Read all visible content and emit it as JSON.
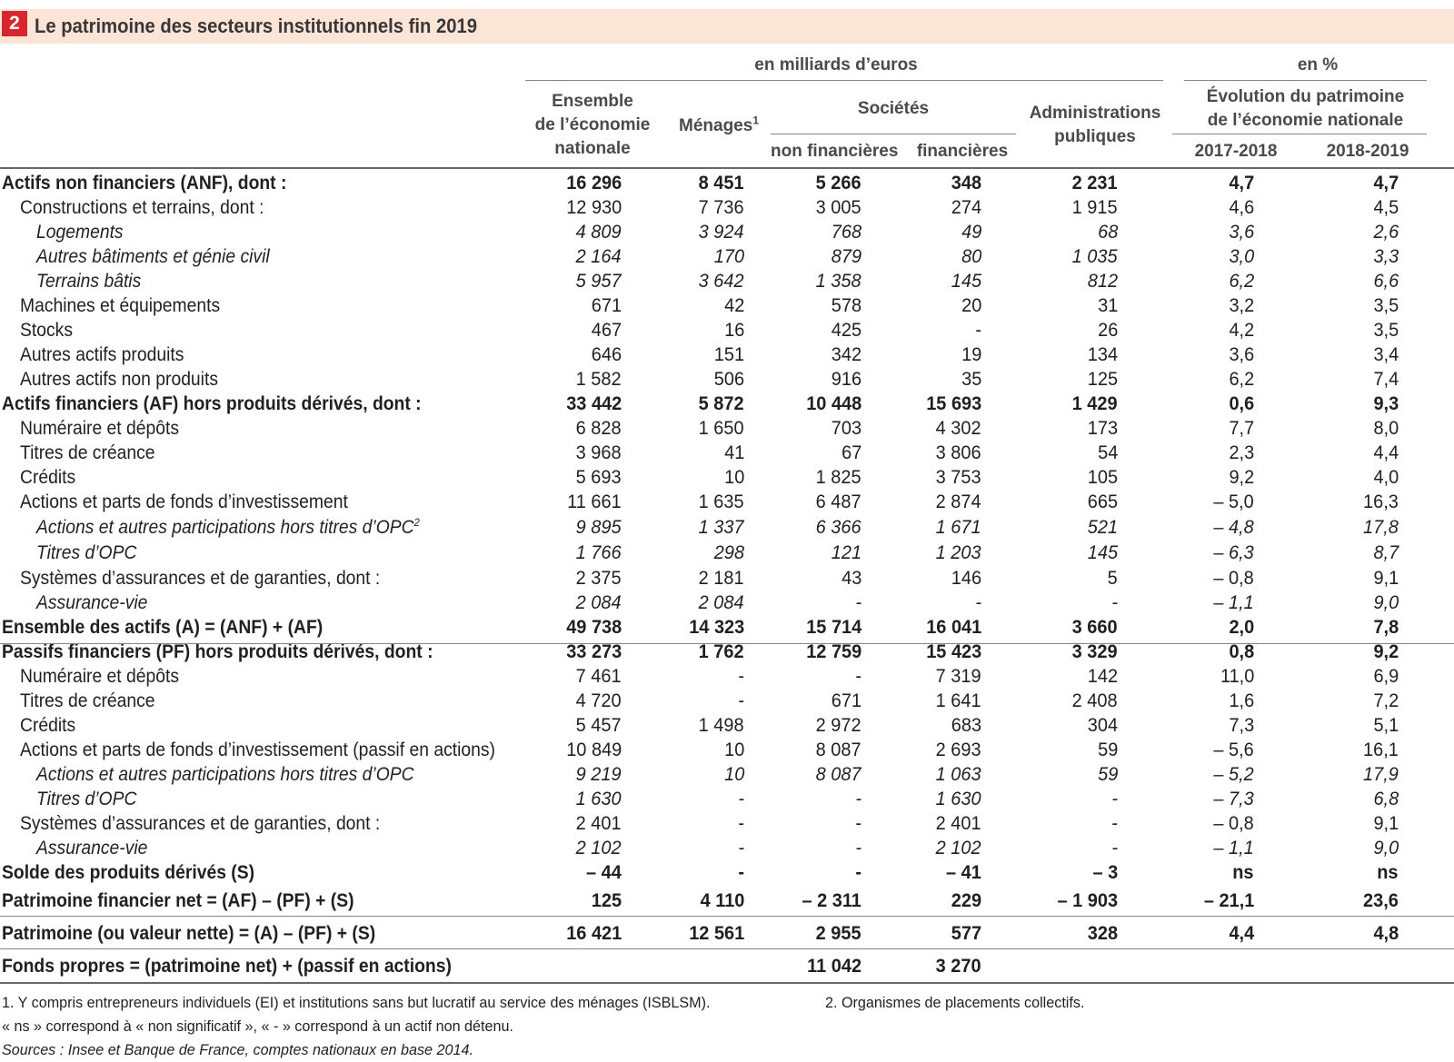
{
  "title": {
    "number": "2",
    "text": "Le patrimoine des secteurs institutionnels fin 2019"
  },
  "header": {
    "unit_eur": "en milliards d’euros",
    "unit_pct": "en %",
    "col_ensemble": [
      "Ensemble",
      "de l’économie",
      "nationale"
    ],
    "col_menages": "Ménages",
    "col_menages_note": "1",
    "col_societes": "Sociétés",
    "col_soc_nf": "non financières",
    "col_soc_f": "financières",
    "col_admin": [
      "Administrations",
      "publiques"
    ],
    "col_evol": [
      "Évolution du patrimoine",
      "de l’économie nationale"
    ],
    "col_2018": "2017-2018",
    "col_2019": "2018-2019"
  },
  "rows": [
    {
      "label": "Actifs non financiers (ANF), dont :",
      "style": "bold",
      "v": [
        "16 296",
        "8 451",
        "5 266",
        "348",
        "2 231",
        "4,7",
        "4,7"
      ]
    },
    {
      "label": "Constructions et terrains, dont :",
      "style": "l1",
      "v": [
        "12 930",
        "7 736",
        "3 005",
        "274",
        "1 915",
        "4,6",
        "4,5"
      ]
    },
    {
      "label": "Logements",
      "style": "l2",
      "v": [
        "4 809",
        "3 924",
        "768",
        "49",
        "68",
        "3,6",
        "2,6"
      ]
    },
    {
      "label": "Autres bâtiments et génie civil",
      "style": "l2",
      "v": [
        "2 164",
        "170",
        "879",
        "80",
        "1 035",
        "3,0",
        "3,3"
      ]
    },
    {
      "label": "Terrains bâtis",
      "style": "l2",
      "v": [
        "5 957",
        "3 642",
        "1 358",
        "145",
        "812",
        "6,2",
        "6,6"
      ]
    },
    {
      "label": "Machines et équipements",
      "style": "l1",
      "v": [
        "671",
        "42",
        "578",
        "20",
        "31",
        "3,2",
        "3,5"
      ]
    },
    {
      "label": "Stocks",
      "style": "l1",
      "v": [
        "467",
        "16",
        "425",
        "-",
        "26",
        "4,2",
        "3,5"
      ]
    },
    {
      "label": "Autres actifs produits",
      "style": "l1",
      "v": [
        "646",
        "151",
        "342",
        "19",
        "134",
        "3,6",
        "3,4"
      ]
    },
    {
      "label": "Autres actifs non produits",
      "style": "l1",
      "v": [
        "1 582",
        "506",
        "916",
        "35",
        "125",
        "6,2",
        "7,4"
      ]
    },
    {
      "label": "Actifs financiers (AF) hors produits dérivés, dont :",
      "style": "bold",
      "v": [
        "33 442",
        "5 872",
        "10 448",
        "15 693",
        "1 429",
        "0,6",
        "9,3"
      ]
    },
    {
      "label": "Numéraire et dépôts",
      "style": "l1",
      "v": [
        "6 828",
        "1 650",
        "703",
        "4 302",
        "173",
        "7,7",
        "8,0"
      ]
    },
    {
      "label": "Titres de créance",
      "style": "l1",
      "v": [
        "3 968",
        "41",
        "67",
        "3 806",
        "54",
        "2,3",
        "4,4"
      ]
    },
    {
      "label": "Crédits",
      "style": "l1",
      "v": [
        "5 693",
        "10",
        "1 825",
        "3 753",
        "105",
        "9,2",
        "4,0"
      ]
    },
    {
      "label": "Actions et parts de fonds d’investissement",
      "style": "l1",
      "v": [
        "11 661",
        "1 635",
        "6 487",
        "2 874",
        "665",
        "– 5,0",
        "16,3"
      ]
    },
    {
      "label": "Actions et autres participations hors titres d’OPC",
      "note": "2",
      "style": "l2",
      "v": [
        "9 895",
        "1 337",
        "6 366",
        "1 671",
        "521",
        "– 4,8",
        "17,8"
      ]
    },
    {
      "label": "Titres d’OPC",
      "style": "l2",
      "v": [
        "1 766",
        "298",
        "121",
        "1 203",
        "145",
        "– 6,3",
        "8,7"
      ]
    },
    {
      "label": "Systèmes d’assurances et de garanties, dont :",
      "style": "l1",
      "v": [
        "2 375",
        "2 181",
        "43",
        "146",
        "5",
        "– 0,8",
        "9,1"
      ]
    },
    {
      "label": "Assurance-vie",
      "style": "l2",
      "v": [
        "2 084",
        "2 084",
        "-",
        "-",
        "-",
        "– 1,1",
        "9,0"
      ]
    },
    {
      "label": "Ensemble des actifs (A) = (ANF) + (AF)",
      "style": "bold",
      "v": [
        "49 738",
        "14 323",
        "15 714",
        "16 041",
        "3 660",
        "2,0",
        "7,8"
      ]
    },
    {
      "label": "Passifs financiers (PF) hors produits dérivés, dont :",
      "style": "bold",
      "v": [
        "33 273",
        "1 762",
        "12 759",
        "15 423",
        "3 329",
        "0,8",
        "9,2"
      ]
    },
    {
      "label": "Numéraire et dépôts",
      "style": "l1",
      "v": [
        "7 461",
        "-",
        "-",
        "7 319",
        "142",
        "11,0",
        "6,9"
      ]
    },
    {
      "label": "Titres de créance",
      "style": "l1",
      "v": [
        "4 720",
        "-",
        "671",
        "1 641",
        "2 408",
        "1,6",
        "7,2"
      ]
    },
    {
      "label": "Crédits",
      "style": "l1",
      "v": [
        "5 457",
        "1 498",
        "2 972",
        "683",
        "304",
        "7,3",
        "5,1"
      ]
    },
    {
      "label": "Actions et parts de fonds d’investissement (passif en actions)",
      "style": "l1",
      "v": [
        "10 849",
        "10",
        "8 087",
        "2 693",
        "59",
        "– 5,6",
        "16,1"
      ]
    },
    {
      "label": "Actions et autres participations hors titres d’OPC",
      "style": "l2",
      "v": [
        "9 219",
        "10",
        "8 087",
        "1 063",
        "59",
        "– 5,2",
        "17,9"
      ]
    },
    {
      "label": "Titres d’OPC",
      "style": "l2",
      "v": [
        "1 630",
        "-",
        "-",
        "1 630",
        "-",
        "– 7,3",
        "6,8"
      ]
    },
    {
      "label": "Systèmes d’assurances et de garanties, dont :",
      "style": "l1",
      "v": [
        "2 401",
        "-",
        "-",
        "2 401",
        "-",
        "– 0,8",
        "9,1"
      ]
    },
    {
      "label": "Assurance-vie",
      "style": "l2",
      "v": [
        "2 102",
        "-",
        "-",
        "2 102",
        "-",
        "– 1,1",
        "9,0"
      ]
    },
    {
      "label": "Solde des produits dérivés (S)",
      "style": "bold",
      "v": [
        "– 44",
        "-",
        "-",
        "– 41",
        "– 3",
        "ns",
        "ns"
      ]
    },
    {
      "label": "Patrimoine financier net = (AF) – (PF) + (S)",
      "style": "bold",
      "v": [
        "125",
        "4 110",
        "– 2 311",
        "229",
        "– 1 903",
        "– 21,1",
        "23,6"
      ]
    },
    {
      "label": "Patrimoine (ou valeur nette) = (A) – (PF) + (S)",
      "style": "bold",
      "v": [
        "16 421",
        "12 561",
        "2 955",
        "577",
        "328",
        "4,4",
        "4,8"
      ]
    },
    {
      "label": "Fonds propres = (patrimoine net) + (passif en actions)",
      "style": "bold",
      "v": [
        "",
        "",
        "11 042",
        "3 270",
        "",
        "",
        ""
      ]
    }
  ],
  "footnotes": {
    "note1": "1. Y compris entrepreneurs individuels (EI) et institutions sans but lucratif au service des ménages (ISBLSM).",
    "note2": "2. Organismes de placements collectifs.",
    "ns": "« ns » correspond à « non significatif », « - » correspond à un actif non détenu.",
    "sources": "Sources : Insee et Banque de France, comptes nationaux en base 2014."
  }
}
